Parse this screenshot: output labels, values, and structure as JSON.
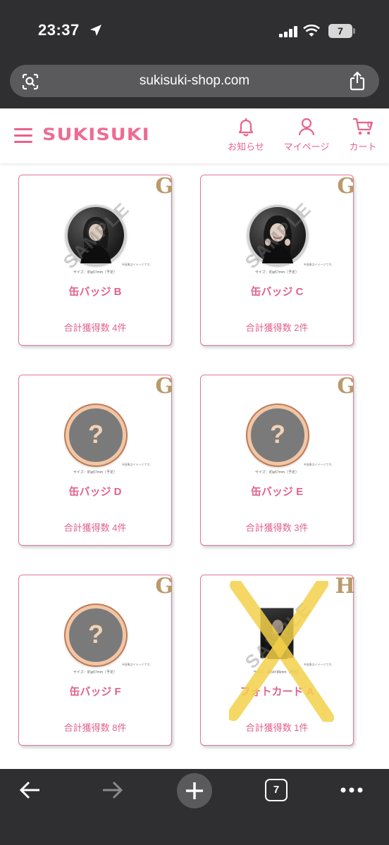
{
  "status_bar": {
    "time": "23:37",
    "battery": "7"
  },
  "browser": {
    "url": "sukisuki-shop.com",
    "tabs_count": "7"
  },
  "header": {
    "logo": "SUKISUKI",
    "notifications_label": "お知らせ",
    "mypage_label": "マイページ",
    "cart_label": "カート",
    "cart_count": "0"
  },
  "items": [
    {
      "letter": "G",
      "name": "缶バッジ B",
      "count": "合計獲得数 4件",
      "size": "サイズ：約φ57mm（予定）",
      "note": "※画像はイメージです。",
      "image": "photo",
      "watermark": "SAMPLE"
    },
    {
      "letter": "G",
      "name": "缶バッジ C",
      "count": "合計獲得数 2件",
      "size": "サイズ：約φ57mm（予定）",
      "note": "※画像はイメージです。",
      "image": "photo",
      "watermark": "SAMPLE"
    },
    {
      "letter": "G",
      "name": "缶バッジ D",
      "count": "合計獲得数 4件",
      "size": "サイズ：約φ57mm（予定）",
      "note": "※画像はイメージです。",
      "image": "unknown",
      "watermark": ""
    },
    {
      "letter": "G",
      "name": "缶バッジ E",
      "count": "合計獲得数 3件",
      "size": "サイズ：約φ57mm（予定）",
      "note": "※画像はイメージです。",
      "image": "unknown",
      "watermark": ""
    },
    {
      "letter": "G",
      "name": "缶バッジ F",
      "count": "合計獲得数 8件",
      "size": "サイズ：約φ57mm（予定）",
      "note": "※画像はイメージです。",
      "image": "unknown",
      "watermark": ""
    },
    {
      "letter": "H",
      "name": "フォトカード A",
      "count": "合計獲得数 1件",
      "size": "サイズ：約54×86mm（予定）",
      "note": "※画像はイメージです。",
      "image": "photocard",
      "watermark": "SAMPLE"
    }
  ],
  "colors": {
    "accent": "#e8628a",
    "letter_gold": "#b99a6a",
    "browser_chrome": "#2f2f31"
  }
}
